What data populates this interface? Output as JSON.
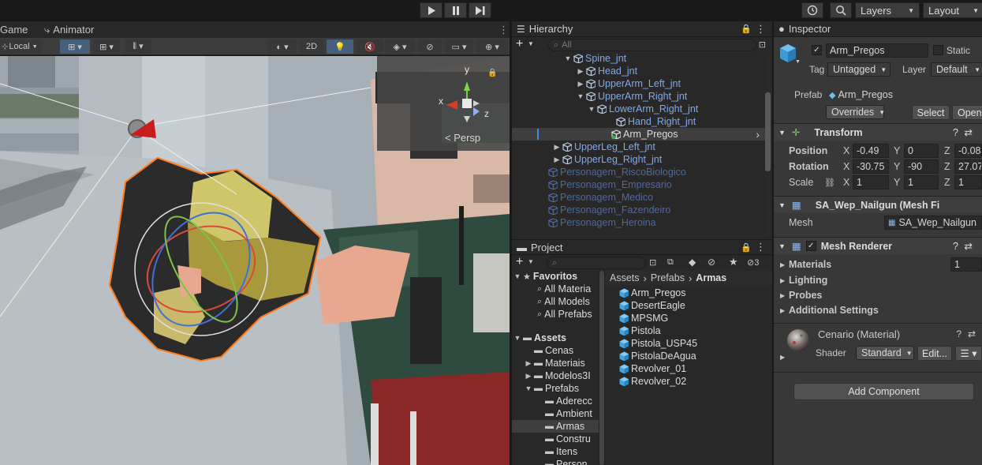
{
  "toolbar": {
    "layers_label": "Layers",
    "layout_label": "Layout"
  },
  "scene": {
    "tab_game": "Game",
    "tab_animator": "Animator",
    "pivot_label": "Local",
    "mode_2d": "2D",
    "persp_label": "< Persp",
    "gizmo_y": "y",
    "gizmo_x": "x",
    "gizmo_z": "z"
  },
  "hierarchy": {
    "title": "Hierarchy",
    "search_placeholder": "All",
    "items": [
      {
        "label": "Spine_jnt",
        "style": "blue",
        "arrow": "▼"
      },
      {
        "label": "Head_jnt",
        "style": "blue",
        "arrow": "▶"
      },
      {
        "label": "UpperArm_Left_jnt",
        "style": "blue",
        "arrow": "▶"
      },
      {
        "label": "UpperArm_Right_jnt",
        "style": "blue",
        "arrow": "▼"
      },
      {
        "label": "LowerArm_Right_jnt",
        "style": "blue",
        "arrow": "▼"
      },
      {
        "label": "Hand_Right_jnt",
        "style": "blue",
        "arrow": ""
      },
      {
        "label": "Arm_Pregos",
        "style": "white",
        "arrow": ""
      },
      {
        "label": "UpperLeg_Left_jnt",
        "style": "blue",
        "arrow": "▶"
      },
      {
        "label": "UpperLeg_Right_jnt",
        "style": "blue",
        "arrow": "▶"
      },
      {
        "label": "Personagem_RiscoBiologico",
        "style": "dim",
        "arrow": ""
      },
      {
        "label": "Personagem_Empresario",
        "style": "dim",
        "arrow": ""
      },
      {
        "label": "Personagem_Medico",
        "style": "dim",
        "arrow": ""
      },
      {
        "label": "Personagem_Fazendeiro",
        "style": "dim",
        "arrow": ""
      },
      {
        "label": "Personagem_Heroina",
        "style": "dim",
        "arrow": ""
      }
    ]
  },
  "project": {
    "title": "Project",
    "hidden_count": "3",
    "favorites_label": "Favoritos",
    "favorites": [
      "All Materia",
      "All Models",
      "All Prefabs"
    ],
    "assets_label": "Assets",
    "folders": [
      {
        "label": "Cenas",
        "arrow": ""
      },
      {
        "label": "Materiais",
        "arrow": "▶"
      },
      {
        "label": "Modelos3I",
        "arrow": "▶"
      },
      {
        "label": "Prefabs",
        "arrow": "▼"
      },
      {
        "label": "Aderecc",
        "arrow": ""
      },
      {
        "label": "Ambient",
        "arrow": ""
      },
      {
        "label": "Armas",
        "arrow": ""
      },
      {
        "label": "Constru",
        "arrow": ""
      },
      {
        "label": "Itens",
        "arrow": ""
      },
      {
        "label": "Person",
        "arrow": ""
      }
    ],
    "breadcrumb": [
      "Assets",
      "Prefabs",
      "Armas"
    ],
    "files": [
      "Arm_Pregos",
      "DesertEagle",
      "MPSMG",
      "Pistola",
      "Pistola_USP45",
      "PistolaDeAgua",
      "Revolver_01",
      "Revolver_02"
    ]
  },
  "inspector": {
    "title": "Inspector",
    "object_name": "Arm_Pregos",
    "static_label": "Static",
    "tag_label": "Tag",
    "tag_value": "Untagged",
    "layer_label": "Layer",
    "layer_value": "Default",
    "prefab_label": "Prefab",
    "prefab_value": "Arm_Pregos",
    "overrides_label": "Overrides",
    "select_label": "Select",
    "open_label": "Open",
    "transform": {
      "title": "Transform",
      "position_label": "Position",
      "rotation_label": "Rotation",
      "scale_label": "Scale",
      "position": {
        "x": "-0.49",
        "y": "0",
        "z": "-0.08"
      },
      "rotation": {
        "x": "-30.75",
        "y": "-90",
        "z": "27.07"
      },
      "scale": {
        "x": "1",
        "y": "1",
        "z": "1"
      }
    },
    "mesh_filter": {
      "title": "SA_Wep_Nailgun (Mesh Fi",
      "mesh_label": "Mesh",
      "mesh_value": "SA_Wep_Nailgun"
    },
    "mesh_renderer": {
      "title": "Mesh Renderer",
      "materials_label": "Materials",
      "materials_count": "1",
      "lighting_label": "Lighting",
      "probes_label": "Probes",
      "additional_label": "Additional Settings"
    },
    "material": {
      "name": "Cenario (Material)",
      "shader_label": "Shader",
      "shader_value": "Standard",
      "edit_label": "Edit..."
    },
    "add_component_label": "Add Component"
  }
}
